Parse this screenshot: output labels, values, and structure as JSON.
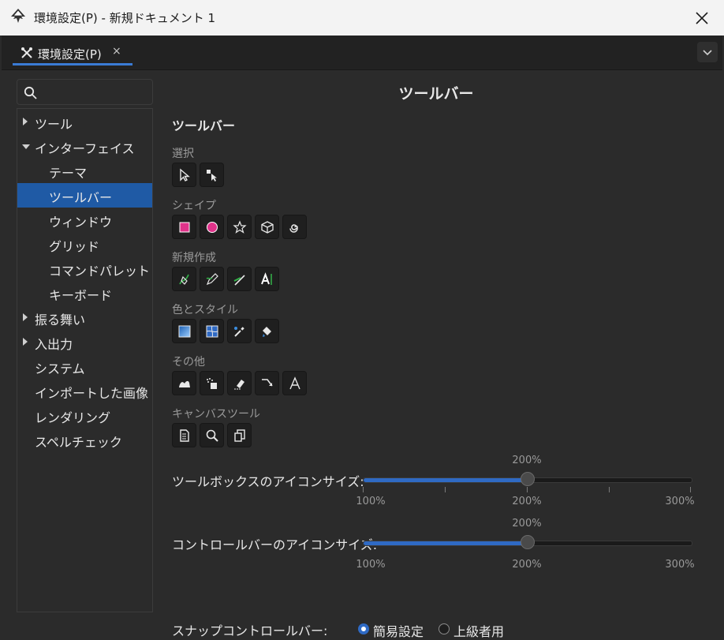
{
  "window": {
    "title": "環境設定(P) - 新規ドキュメント 1"
  },
  "tab": {
    "label": "環境設定(P)",
    "close": "×"
  },
  "search": {
    "placeholder": "",
    "value": ""
  },
  "sidebar": {
    "items": [
      {
        "label": "ツール",
        "arrow": "right"
      },
      {
        "label": "インターフェイス",
        "arrow": "down"
      },
      {
        "label": "テーマ"
      },
      {
        "label": "ツールバー",
        "selected": true
      },
      {
        "label": "ウィンドウ"
      },
      {
        "label": "グリッド"
      },
      {
        "label": "コマンドパレット"
      },
      {
        "label": "キーボード"
      },
      {
        "label": "振る舞い",
        "arrow": "right"
      },
      {
        "label": "入出力",
        "arrow": "right"
      },
      {
        "label": "システム"
      },
      {
        "label": "インポートした画像"
      },
      {
        "label": "レンダリング"
      },
      {
        "label": "スペルチェック"
      }
    ]
  },
  "main": {
    "page_title": "ツールバー",
    "section_title": "ツールバー",
    "groups": [
      {
        "label": "選択",
        "icons": [
          "selector-tool-icon",
          "node-tool-icon"
        ]
      },
      {
        "label": "シェイプ",
        "icons": [
          "rectangle-tool-icon",
          "ellipse-tool-icon",
          "star-tool-icon",
          "box3d-tool-icon",
          "spiral-tool-icon"
        ]
      },
      {
        "label": "新規作成",
        "icons": [
          "pen-tool-icon",
          "pencil-tool-icon",
          "calligraphy-tool-icon",
          "text-tool-icon"
        ]
      },
      {
        "label": "色とスタイル",
        "icons": [
          "gradient-tool-icon",
          "mesh-tool-icon",
          "dropper-tool-icon",
          "paint-bucket-tool-icon"
        ]
      },
      {
        "label": "その他",
        "icons": [
          "tweak-tool-icon",
          "spray-tool-icon",
          "eraser-tool-icon",
          "connector-tool-icon",
          "lpe-tool-icon"
        ]
      },
      {
        "label": "キャンバスツール",
        "icons": [
          "pages-tool-icon",
          "zoom-tool-icon",
          "measure-tool-icon"
        ]
      }
    ],
    "toolbox_icon_size": {
      "label": "ツールボックスのアイコンサイズ:",
      "value_label": "200%",
      "value_fraction": 0.5,
      "ticks": [
        "100%",
        "200%",
        "300%"
      ]
    },
    "control_icon_size": {
      "label": "コントロールバーのアイコンサイズ:",
      "value_label": "200%",
      "value_fraction": 0.5,
      "ticks": [
        "100%",
        "200%",
        "300%"
      ]
    },
    "snap_bar": {
      "label": "スナップコントロールバー:",
      "options": [
        {
          "label": "簡易設定",
          "checked": true
        },
        {
          "label": "上級者用",
          "checked": false
        }
      ]
    }
  },
  "colors": {
    "accent": "#2f6ac4",
    "selected_bg": "#1f5aa5",
    "shape_pink": "#e0338a"
  }
}
